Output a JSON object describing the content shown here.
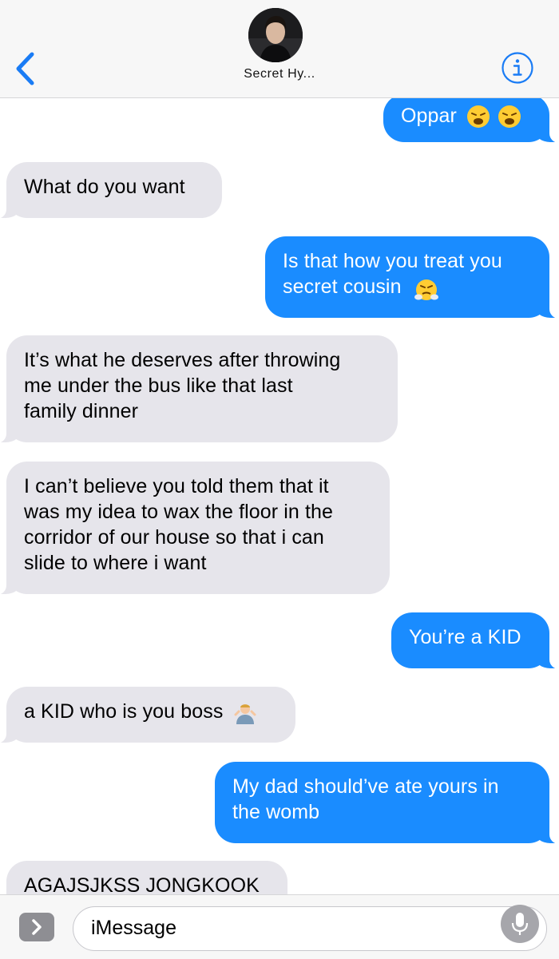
{
  "header": {
    "contact_name": "Secret Hy...",
    "back_icon": "chevron-left-icon",
    "info_icon": "info-icon"
  },
  "messages": [
    {
      "from": "me",
      "text": "Oppar",
      "emoji": [
        "weary-face",
        "weary-face"
      ]
    },
    {
      "from": "them",
      "text": "What do you want"
    },
    {
      "from": "me",
      "text": "Is that how you treat you\nsecret cousin",
      "emoji": [
        "face-with-steam"
      ]
    },
    {
      "from": "them",
      "text": "It’s what he deserves after throwing\nme under the bus like that last\nfamily dinner"
    },
    {
      "from": "them",
      "text": "I can’t believe you told them that it\nwas my idea to wax the floor in the\ncorridor of our house so that i can\nslide to where i want"
    },
    {
      "from": "me",
      "text": "You’re a KID"
    },
    {
      "from": "them",
      "text": "a KID who is you boss",
      "emoji": [
        "man-shrugging"
      ]
    },
    {
      "from": "me",
      "text": "My dad should’ve ate yours in\nthe womb"
    },
    {
      "from": "them",
      "text": "AGAJSJKSS JONGKOOK"
    }
  ],
  "input_bar": {
    "placeholder": "iMessage",
    "expand_icon": "chevron-right-icon",
    "mic_icon": "microphone-icon"
  },
  "colors": {
    "sent_bubble": "#1a8cff",
    "received_bubble": "#e6e5eb",
    "accent": "#1a7cf5"
  }
}
